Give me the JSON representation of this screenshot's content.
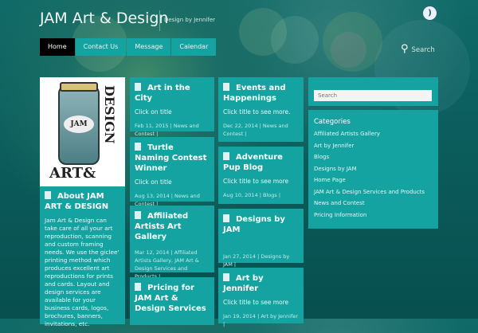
{
  "header": {
    "title": "JAM Art & Design",
    "tagline": "Design by Jennifer",
    "rss_icon": "rss-icon",
    "search_label": "Search"
  },
  "nav": [
    {
      "label": "Home",
      "active": true
    },
    {
      "label": "Contact Us"
    },
    {
      "label": "Message"
    },
    {
      "label": "Calendar"
    }
  ],
  "about": {
    "title": "About JAM ART & DESIGN",
    "text": "Jam Art & Design can take care of all your art reproduction, scanning and custom framing needs.  We use the giclee' printing method which produces excellent art reproductions for prints and cards.  Layout and design services are available for your business cards, logos, brochures, banners, invitations, etc.",
    "logo_text": "JAM ART & DESIGN"
  },
  "posts": [
    {
      "title": "Art in the City",
      "excerpt": "Click on title",
      "meta": "Feb 11, 2015  |  News and Contest  |"
    },
    {
      "title": "Turtle Naming Contest Winner",
      "excerpt": "Click on title",
      "meta": "Aug 13, 2014  |  News and Contest  |"
    },
    {
      "title": "Affiliated Artists Art Gallery",
      "excerpt": "",
      "meta": "Mar 12, 2014  |  Affiliated Artists Gallery, JAM Art & Design Services and Products  |"
    },
    {
      "title": "Pricing for JAM Art & Design Services",
      "excerpt": "",
      "meta": ""
    },
    {
      "title": "Events and Happenings",
      "excerpt": "Click title to see more.",
      "meta": "Dec 22, 2014  |  News and Contest  |"
    },
    {
      "title": "Adventure Pup Blog",
      "excerpt": "Click title to see more",
      "meta": "Aug 10, 2014  |  Blogs  |"
    },
    {
      "title": "Designs by JAM",
      "excerpt": "",
      "meta": "Jan 27, 2014  |  Designs by JAM  |"
    },
    {
      "title": "Art by Jennifer",
      "excerpt": "Click title to see more",
      "meta": "Jan 19, 2014  |  Art by Jennifer  |"
    }
  ],
  "sidebar": {
    "search_placeholder": "Search",
    "categories_title": "Categories",
    "categories": [
      "Affiliated Artists Gallery",
      "Art by Jennifer",
      "Blogs",
      "Designs by JAM",
      "Home Page",
      "JAM Art & Design Services and Products",
      "News and Contest",
      "Pricing Information"
    ]
  }
}
